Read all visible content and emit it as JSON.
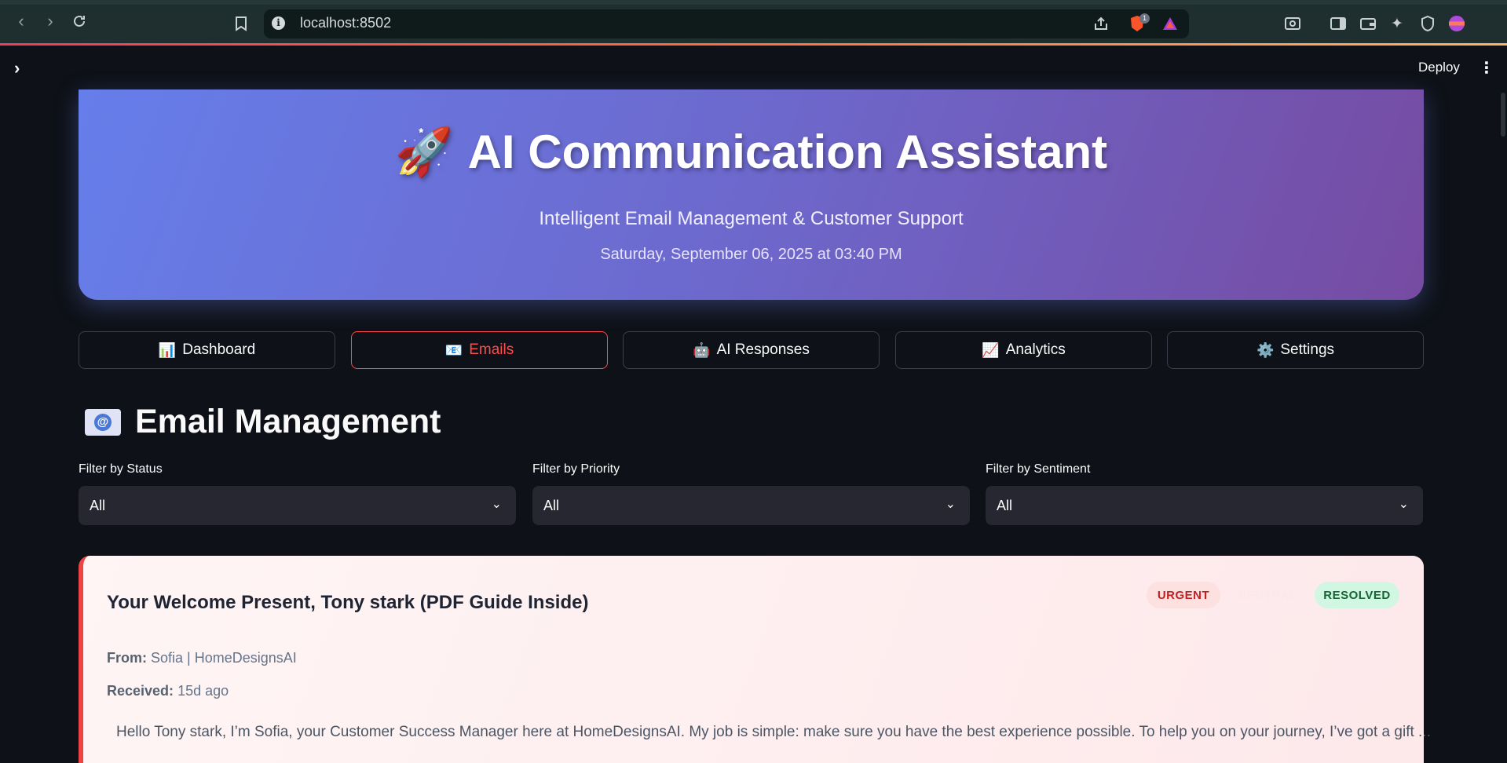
{
  "browser": {
    "url": "localhost:8502",
    "shields_count": "1"
  },
  "app": {
    "deploy_label": "Deploy"
  },
  "hero": {
    "icon": "🚀",
    "title": "AI Communication Assistant",
    "subtitle": "Intelligent Email Management & Customer Support",
    "datetime": "Saturday, September 06, 2025 at 03:40 PM"
  },
  "tabs": [
    {
      "icon": "📊",
      "label": "Dashboard"
    },
    {
      "icon": "📧",
      "label": "Emails"
    },
    {
      "icon": "🤖",
      "label": "AI Responses"
    },
    {
      "icon": "📈",
      "label": "Analytics"
    },
    {
      "icon": "⚙️",
      "label": "Settings"
    }
  ],
  "active_tab": "Emails",
  "section": {
    "title": "Email Management"
  },
  "filters": [
    {
      "label": "Filter by Status",
      "value": "All"
    },
    {
      "label": "Filter by Priority",
      "value": "All"
    },
    {
      "label": "Filter by Sentiment",
      "value": "All"
    }
  ],
  "email": {
    "subject": "Your Welcome Present, Tony stark (PDF Guide Inside)",
    "badges": {
      "priority": "URGENT",
      "sentiment": "NEUTRAL",
      "status": "RESOLVED"
    },
    "from_label": "From:",
    "from": "Sofia | HomeDesignsAI",
    "received_label": "Received:",
    "received": "15d ago",
    "preview": "Hello Tony stark, I’m Sofia, your Customer Success Manager here at HomeDesignsAI. My job is simple: make sure you have the best experience possible. To help you on your journey, I’ve got a gift ..."
  },
  "colors": {
    "accent": "#ff4b4b",
    "hero_start": "#667eea",
    "hero_end": "#764ba2",
    "urgent": "#c02222",
    "resolved": "#166534"
  }
}
